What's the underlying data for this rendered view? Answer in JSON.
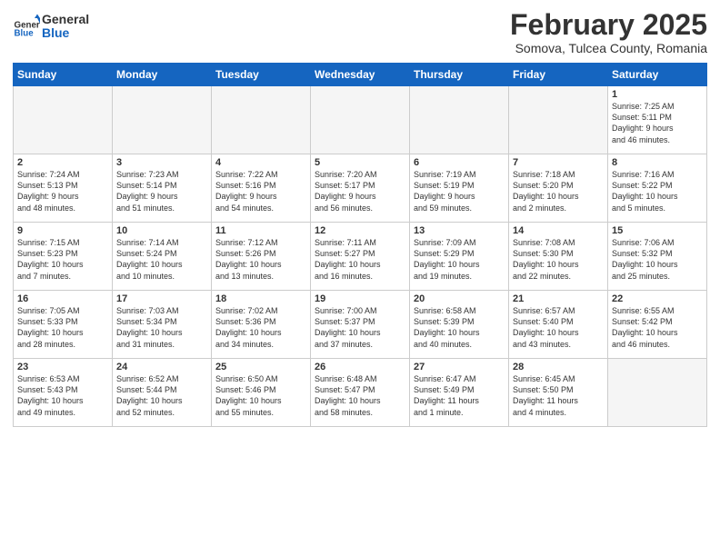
{
  "header": {
    "logo": {
      "general": "General",
      "blue": "Blue"
    },
    "title": "February 2025",
    "location": "Somova, Tulcea County, Romania"
  },
  "weekdays": [
    "Sunday",
    "Monday",
    "Tuesday",
    "Wednesday",
    "Thursday",
    "Friday",
    "Saturday"
  ],
  "weeks": [
    [
      {
        "day": "",
        "info": ""
      },
      {
        "day": "",
        "info": ""
      },
      {
        "day": "",
        "info": ""
      },
      {
        "day": "",
        "info": ""
      },
      {
        "day": "",
        "info": ""
      },
      {
        "day": "",
        "info": ""
      },
      {
        "day": "1",
        "info": "Sunrise: 7:25 AM\nSunset: 5:11 PM\nDaylight: 9 hours\nand 46 minutes."
      }
    ],
    [
      {
        "day": "2",
        "info": "Sunrise: 7:24 AM\nSunset: 5:13 PM\nDaylight: 9 hours\nand 48 minutes."
      },
      {
        "day": "3",
        "info": "Sunrise: 7:23 AM\nSunset: 5:14 PM\nDaylight: 9 hours\nand 51 minutes."
      },
      {
        "day": "4",
        "info": "Sunrise: 7:22 AM\nSunset: 5:16 PM\nDaylight: 9 hours\nand 54 minutes."
      },
      {
        "day": "5",
        "info": "Sunrise: 7:20 AM\nSunset: 5:17 PM\nDaylight: 9 hours\nand 56 minutes."
      },
      {
        "day": "6",
        "info": "Sunrise: 7:19 AM\nSunset: 5:19 PM\nDaylight: 9 hours\nand 59 minutes."
      },
      {
        "day": "7",
        "info": "Sunrise: 7:18 AM\nSunset: 5:20 PM\nDaylight: 10 hours\nand 2 minutes."
      },
      {
        "day": "8",
        "info": "Sunrise: 7:16 AM\nSunset: 5:22 PM\nDaylight: 10 hours\nand 5 minutes."
      }
    ],
    [
      {
        "day": "9",
        "info": "Sunrise: 7:15 AM\nSunset: 5:23 PM\nDaylight: 10 hours\nand 7 minutes."
      },
      {
        "day": "10",
        "info": "Sunrise: 7:14 AM\nSunset: 5:24 PM\nDaylight: 10 hours\nand 10 minutes."
      },
      {
        "day": "11",
        "info": "Sunrise: 7:12 AM\nSunset: 5:26 PM\nDaylight: 10 hours\nand 13 minutes."
      },
      {
        "day": "12",
        "info": "Sunrise: 7:11 AM\nSunset: 5:27 PM\nDaylight: 10 hours\nand 16 minutes."
      },
      {
        "day": "13",
        "info": "Sunrise: 7:09 AM\nSunset: 5:29 PM\nDaylight: 10 hours\nand 19 minutes."
      },
      {
        "day": "14",
        "info": "Sunrise: 7:08 AM\nSunset: 5:30 PM\nDaylight: 10 hours\nand 22 minutes."
      },
      {
        "day": "15",
        "info": "Sunrise: 7:06 AM\nSunset: 5:32 PM\nDaylight: 10 hours\nand 25 minutes."
      }
    ],
    [
      {
        "day": "16",
        "info": "Sunrise: 7:05 AM\nSunset: 5:33 PM\nDaylight: 10 hours\nand 28 minutes."
      },
      {
        "day": "17",
        "info": "Sunrise: 7:03 AM\nSunset: 5:34 PM\nDaylight: 10 hours\nand 31 minutes."
      },
      {
        "day": "18",
        "info": "Sunrise: 7:02 AM\nSunset: 5:36 PM\nDaylight: 10 hours\nand 34 minutes."
      },
      {
        "day": "19",
        "info": "Sunrise: 7:00 AM\nSunset: 5:37 PM\nDaylight: 10 hours\nand 37 minutes."
      },
      {
        "day": "20",
        "info": "Sunrise: 6:58 AM\nSunset: 5:39 PM\nDaylight: 10 hours\nand 40 minutes."
      },
      {
        "day": "21",
        "info": "Sunrise: 6:57 AM\nSunset: 5:40 PM\nDaylight: 10 hours\nand 43 minutes."
      },
      {
        "day": "22",
        "info": "Sunrise: 6:55 AM\nSunset: 5:42 PM\nDaylight: 10 hours\nand 46 minutes."
      }
    ],
    [
      {
        "day": "23",
        "info": "Sunrise: 6:53 AM\nSunset: 5:43 PM\nDaylight: 10 hours\nand 49 minutes."
      },
      {
        "day": "24",
        "info": "Sunrise: 6:52 AM\nSunset: 5:44 PM\nDaylight: 10 hours\nand 52 minutes."
      },
      {
        "day": "25",
        "info": "Sunrise: 6:50 AM\nSunset: 5:46 PM\nDaylight: 10 hours\nand 55 minutes."
      },
      {
        "day": "26",
        "info": "Sunrise: 6:48 AM\nSunset: 5:47 PM\nDaylight: 10 hours\nand 58 minutes."
      },
      {
        "day": "27",
        "info": "Sunrise: 6:47 AM\nSunset: 5:49 PM\nDaylight: 11 hours\nand 1 minute."
      },
      {
        "day": "28",
        "info": "Sunrise: 6:45 AM\nSunset: 5:50 PM\nDaylight: 11 hours\nand 4 minutes."
      },
      {
        "day": "",
        "info": ""
      }
    ]
  ]
}
